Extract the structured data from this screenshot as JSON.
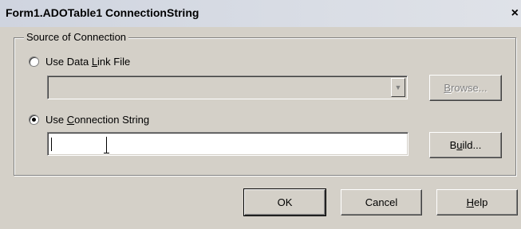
{
  "window": {
    "title": "Form1.ADOTable1 ConnectionString",
    "close_glyph": "×"
  },
  "group": {
    "caption": "Source of Connection"
  },
  "data_link": {
    "label_pre": "Use Data ",
    "label_mn": "L",
    "label_post": "ink File",
    "selected": false,
    "value": "",
    "browse_pre": "",
    "browse_mn": "B",
    "browse_post": "rowse..."
  },
  "conn_string": {
    "label_pre": "Use ",
    "label_mn": "C",
    "label_post": "onnection String",
    "selected": true,
    "value": "",
    "build_pre": "B",
    "build_mn": "u",
    "build_post": "ild..."
  },
  "buttons": {
    "ok": "OK",
    "cancel": "Cancel",
    "help_mn": "H",
    "help_post": "elp"
  }
}
